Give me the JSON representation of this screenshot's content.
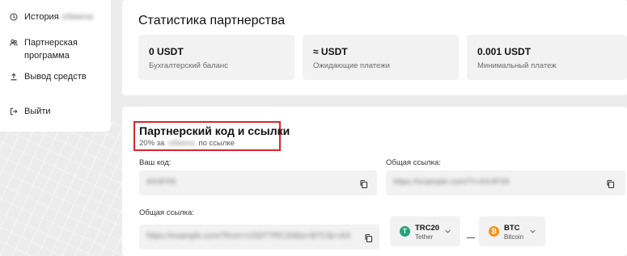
{
  "sidebar": {
    "items": [
      {
        "icon": "history-icon",
        "label": "История",
        "blurred": "обмена"
      },
      {
        "icon": "partners-icon",
        "label": "Партнерская",
        "label2": "программа"
      },
      {
        "icon": "withdraw-icon",
        "label": "Вывод средств"
      },
      {
        "icon": "logout-icon",
        "label": "Выйти"
      }
    ]
  },
  "stats": {
    "title": "Статистика партнерства",
    "cards": [
      {
        "value": "0 USDT",
        "caption": "Бухгалтерский баланс"
      },
      {
        "value": "≈ USDT",
        "caption": "Ожидающие платежи"
      },
      {
        "value": "0.001 USDT",
        "caption": "Минимальный платеж"
      }
    ]
  },
  "referral": {
    "title": "Партнерский код и ссылки",
    "subtitle_prefix": "20% за",
    "subtitle_blurred": "обмена",
    "subtitle_suffix": "по ссылке",
    "code_label": "Ваш код:",
    "code_value": "AX4F09",
    "link_label_right": "Общая ссылка:",
    "link_value_right": "https://example.com/?r=AX4F09",
    "link_label_bottom": "Общая ссылка:",
    "link_value_bottom": "https://example.com/?from=USDTTRC20&to=BTC&r=AX4F09"
  },
  "currency": {
    "from": {
      "code": "TRC20",
      "name": "Tether",
      "symbol": "T",
      "color": "#26a17b"
    },
    "to": {
      "code": "BTC",
      "name": "Bitcoin",
      "symbol": "₿",
      "color": "#f7931a"
    }
  },
  "colors": {
    "highlight": "#d9262c",
    "background": "#ececec",
    "card": "#ffffff",
    "field": "#f2f2f2"
  }
}
